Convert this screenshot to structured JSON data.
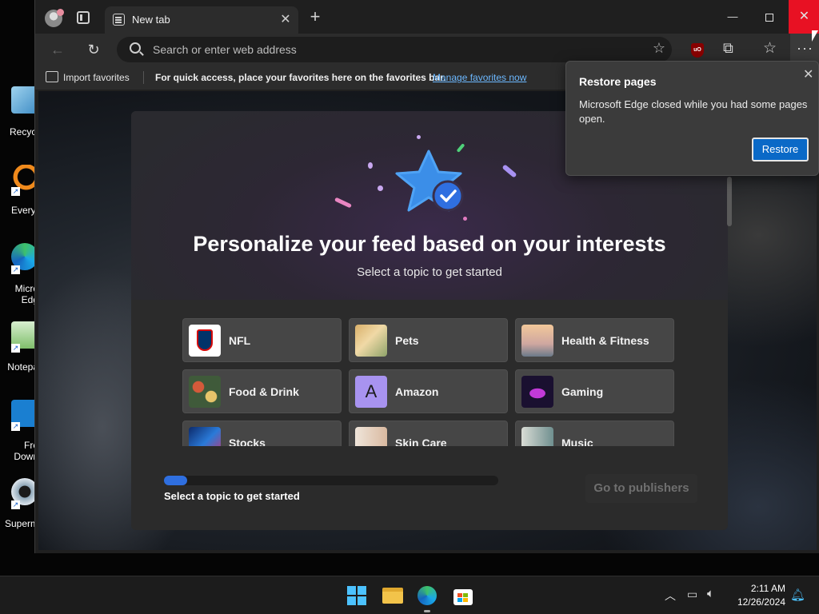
{
  "desktop": {
    "icons": [
      {
        "label1": "Recycl",
        "label2": ""
      },
      {
        "label1": "Everyt",
        "label2": ""
      },
      {
        "label1": "Micro",
        "label2": "Edg"
      },
      {
        "label1": "Notepa",
        "label2": ""
      },
      {
        "label1": "Fre",
        "label2": "Down"
      },
      {
        "label1": "Superm",
        "label2": ""
      }
    ]
  },
  "browser": {
    "tab_title": "New tab",
    "tab_close": "✕",
    "new_tab": "+",
    "window": {
      "minimize": "—",
      "close": "✕"
    },
    "address_placeholder": "Search or enter web address",
    "more_label": "···",
    "favorites_bar": {
      "import_label": "Import favorites",
      "message": "For quick access, place your favorites here on the favorites bar.",
      "link": "Manage favorites now"
    }
  },
  "feed": {
    "title": "Personalize your feed based on your interests",
    "subtitle": "Select a topic to get started",
    "topics": [
      {
        "label": "NFL",
        "icon": "nfl-logo"
      },
      {
        "label": "Pets",
        "icon": "pets-photo"
      },
      {
        "label": "Health & Fitness",
        "icon": "fitness-photo"
      },
      {
        "label": "Food & Drink",
        "icon": "food-photo"
      },
      {
        "label": "Amazon",
        "icon": "amazon-letter",
        "letter": "A"
      },
      {
        "label": "Gaming",
        "icon": "gaming-photo"
      },
      {
        "label": "Stocks",
        "icon": "stocks-photo"
      },
      {
        "label": "Skin Care",
        "icon": "skincare-photo"
      },
      {
        "label": "Music",
        "icon": "music-photo"
      }
    ],
    "progress_fraction": 0.07,
    "progress_label": "Select a topic to get started",
    "go_button": "Go to publishers"
  },
  "restore_popup": {
    "title": "Restore pages",
    "message": "Microsoft Edge closed while you had some pages open.",
    "button": "Restore",
    "close": "✕"
  },
  "taskbar": {
    "time": "2:11 AM",
    "date": "12/26/2024"
  },
  "colors": {
    "accent": "#0a69c7",
    "close_red": "#e81123",
    "link": "#6cb8ff",
    "progress": "#2f6fe0"
  }
}
